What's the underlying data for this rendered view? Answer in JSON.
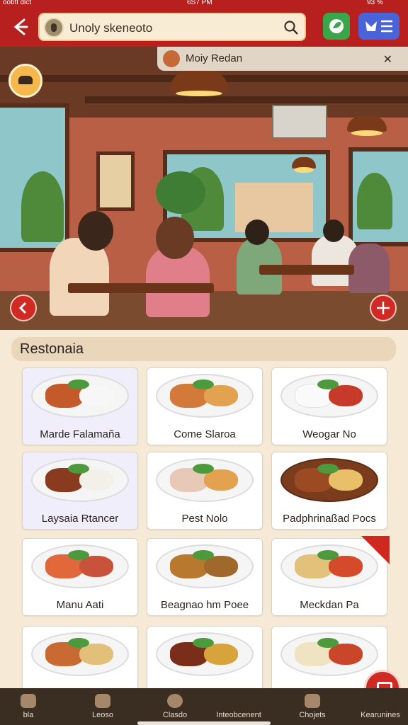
{
  "status_bar": {
    "left": "ootıtl dlct",
    "time": "6S7 PM",
    "battery": "93 %"
  },
  "top_bar": {
    "search_text": "Unoly skeneoto",
    "back_icon": "back-arrow-icon",
    "search_icon": "magnifier-icon",
    "action_green_icon": "leaf-icon",
    "action_blue_icon": "menu-icon"
  },
  "hero": {
    "restaurant_name": "Moiy Redan",
    "restaurant_icon": "bread-icon",
    "close_icon": "cross-icon",
    "prev_icon": "chevron-left-icon",
    "next_icon": "move-icon"
  },
  "section": {
    "title": "Restonaia"
  },
  "dishes": [
    {
      "label": "Marde Falamaña"
    },
    {
      "label": "Come Slaroa"
    },
    {
      "label": "Weogar No"
    },
    {
      "label": "Laysaia Rtancer"
    },
    {
      "label": "Pest Nolo"
    },
    {
      "label": "Padphrinaßad Pocs"
    },
    {
      "label": "Manu Aati"
    },
    {
      "label": "Beagnao hm Poee"
    },
    {
      "label": "Meckdan Pa"
    },
    {
      "label": ""
    },
    {
      "label": ""
    },
    {
      "label": ""
    }
  ],
  "bottom_nav": [
    {
      "label": "bla"
    },
    {
      "label": "Leoso"
    },
    {
      "label": "Clasdo"
    },
    {
      "label": "Inteobcenent"
    },
    {
      "label": "Chojets"
    },
    {
      "label": "Kearunines"
    }
  ],
  "fab_icon": "camera-icon"
}
